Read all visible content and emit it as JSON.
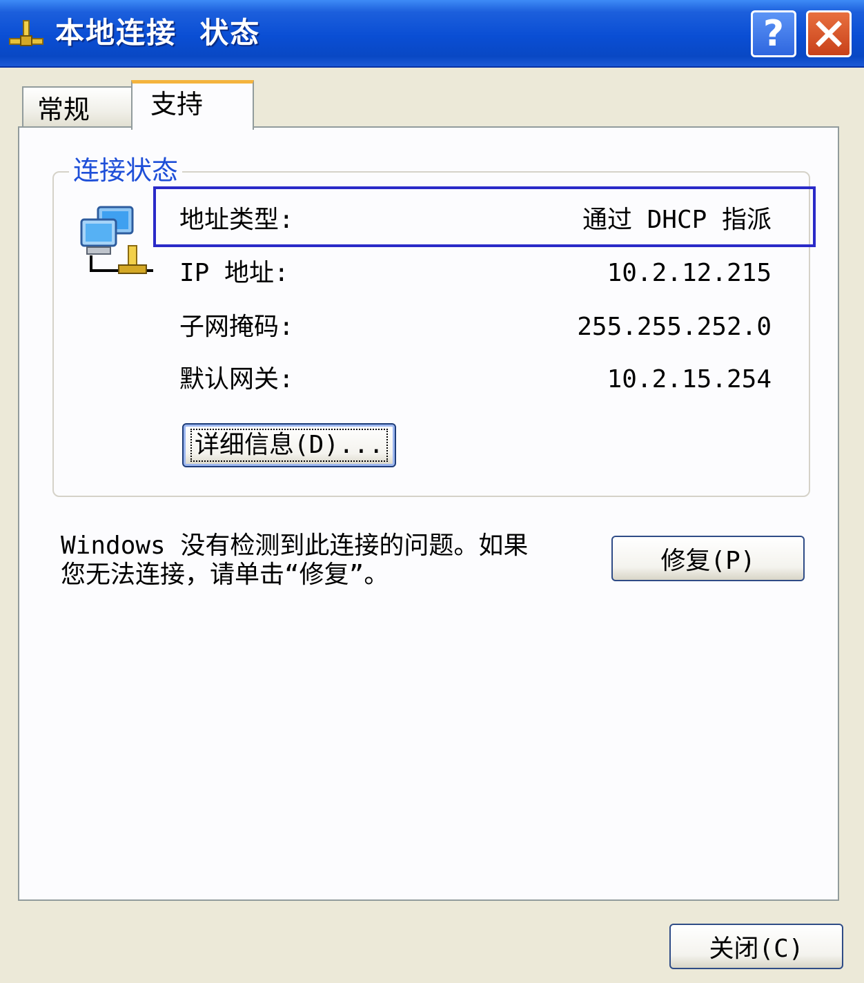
{
  "window": {
    "title": "本地连接  状态",
    "help_label": "?"
  },
  "tabs": [
    {
      "label": "常规",
      "selected": false
    },
    {
      "label": "支持",
      "selected": true
    }
  ],
  "connection_status": {
    "group_title": "连接状态",
    "rows": [
      {
        "label": "地址类型:",
        "value": "通过 DHCP 指派"
      },
      {
        "label": "IP 地址:",
        "value": "10.2.12.215"
      },
      {
        "label": "子网掩码:",
        "value": "255.255.252.0"
      },
      {
        "label": "默认网关:",
        "value": "10.2.15.254"
      }
    ],
    "details_button": "详细信息(D)..."
  },
  "message": "Windows 没有检测到此连接的问题。如果\n您无法连接，请单击“修复”。",
  "repair_button": "修复(P)",
  "close_button": "关闭(C)",
  "colors": {
    "titlebar": "#0A4ED4",
    "dialog_bg": "#ECE9D8",
    "panel_bg": "#FCFCFE",
    "group_title": "#1E4FD8",
    "highlight_box": "#2A2AC8",
    "tab_accent": "#F4B43E"
  },
  "icons": [
    "network-connection-icon",
    "help-icon",
    "close-icon"
  ]
}
